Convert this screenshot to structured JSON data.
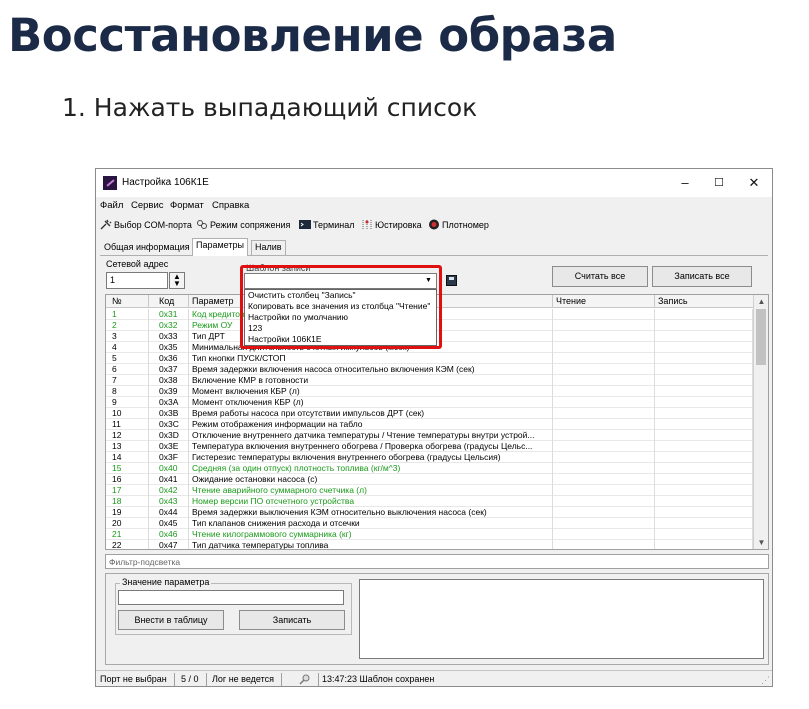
{
  "article": {
    "title": "Восстановление образа",
    "step": "1. Нажать выпадающий список"
  },
  "window": {
    "title": "Настройка 106К1Е",
    "controls": {
      "minimize": "–",
      "maximize": "☐",
      "close": "✕"
    }
  },
  "menu": [
    "Файл",
    "Сервис",
    "Формат",
    "Справка"
  ],
  "toolbar": {
    "com_port": "Выбор COM-порта",
    "pairing_mode": "Режим сопряжения",
    "terminal": "Терминал",
    "adjustment": "Юстировка",
    "densitometer": "Плотномер"
  },
  "tabs": [
    "Общая информация",
    "Параметры",
    "Налив"
  ],
  "network_address": {
    "label": "Сетевой адрес",
    "value": "1",
    "spin": "▲\n▼"
  },
  "template": {
    "label": "Шаблон записи",
    "value": "",
    "arrow": "▼"
  },
  "buttons": {
    "read_all": "Считать все",
    "write_all": "Записать все",
    "put_in_table": "Внести в таблицу",
    "write": "Записать"
  },
  "table": {
    "columns": [
      "№",
      "Код",
      "Параметр",
      "Чтение",
      "Запись"
    ],
    "rows": [
      {
        "num": "1",
        "code": "0x31",
        "param": "Код кредитования",
        "green": true
      },
      {
        "num": "2",
        "code": "0x32",
        "param": "Режим ОУ",
        "green": true
      },
      {
        "num": "3",
        "code": "0x33",
        "param": "Тип ДРТ",
        "green": false
      },
      {
        "num": "4",
        "code": "0x35",
        "param": "Минимальная длительность счетных импульсов (мсек)",
        "green": false
      },
      {
        "num": "5",
        "code": "0x36",
        "param": "Тип кнопки ПУСК/СТОП",
        "green": false
      },
      {
        "num": "6",
        "code": "0x37",
        "param": "Время задержки включения насоса относительно включения КЭМ (сек)",
        "green": false
      },
      {
        "num": "7",
        "code": "0x38",
        "param": "Включение КМР в готовности",
        "green": false
      },
      {
        "num": "8",
        "code": "0x39",
        "param": "Момент включения КБР (л)",
        "green": false
      },
      {
        "num": "9",
        "code": "0x3A",
        "param": "Момент отключения КБР (л)",
        "green": false
      },
      {
        "num": "10",
        "code": "0x3B",
        "param": "Время работы насоса при отсутствии импульсов ДРТ (сек)",
        "green": false
      },
      {
        "num": "11",
        "code": "0x3C",
        "param": "Режим отображения информации на табло",
        "green": false
      },
      {
        "num": "12",
        "code": "0x3D",
        "param": "Отключение внутреннего датчика температуры / Чтение температуры внутри устрой...",
        "green": false
      },
      {
        "num": "13",
        "code": "0x3E",
        "param": "Температура включения внутреннего обогрева / Проверка обогрева (градусы Цельс...",
        "green": false
      },
      {
        "num": "14",
        "code": "0x3F",
        "param": "Гистерезис температуры включения внутреннего обогрева (градусы Цельсия)",
        "green": false
      },
      {
        "num": "15",
        "code": "0x40",
        "param": "Средняя (за один отпуск) плотность топлива (кг/м^3)",
        "green": true
      },
      {
        "num": "16",
        "code": "0x41",
        "param": "Ожидание остановки насоса (с)",
        "green": false
      },
      {
        "num": "17",
        "code": "0x42",
        "param": "Чтение аварийного суммарного счетчика (л)",
        "green": true
      },
      {
        "num": "18",
        "code": "0x43",
        "param": "Номер версии ПО отсчетного устройства",
        "green": true
      },
      {
        "num": "19",
        "code": "0x44",
        "param": "Время задержки выключения КЭМ относительно выключения насоса (сек)",
        "green": false
      },
      {
        "num": "20",
        "code": "0x45",
        "param": "Тип клапанов снижения расхода и отсечки",
        "green": false
      },
      {
        "num": "21",
        "code": "0x46",
        "param": "Чтение килограммового суммарника (кг)",
        "green": true
      },
      {
        "num": "22",
        "code": "0x47",
        "param": "Тип датчика температуры топлива",
        "green": false
      }
    ]
  },
  "dropdown_options": [
    "Очистить столбец \"Запись\"",
    "Копировать все значения из столбца \"Чтение\"",
    "Настройки по умолчанию",
    "123",
    "Настройки 106К1Е"
  ],
  "filter": {
    "placeholder": "Фильтр-подсветка"
  },
  "param_value": {
    "label": "Значение параметра",
    "value": ""
  },
  "scroll": {
    "up": "▲",
    "down": "▼"
  },
  "status": {
    "port": "Порт не выбран",
    "counter": "5 / 0",
    "log": "Лог не ведется",
    "message": "13:47:23 Шаблон сохранен",
    "grip": "⋰"
  },
  "colors": {
    "title": "#1b2a47",
    "highlight": "#e01010",
    "green_rows": "#1a9a1a"
  }
}
